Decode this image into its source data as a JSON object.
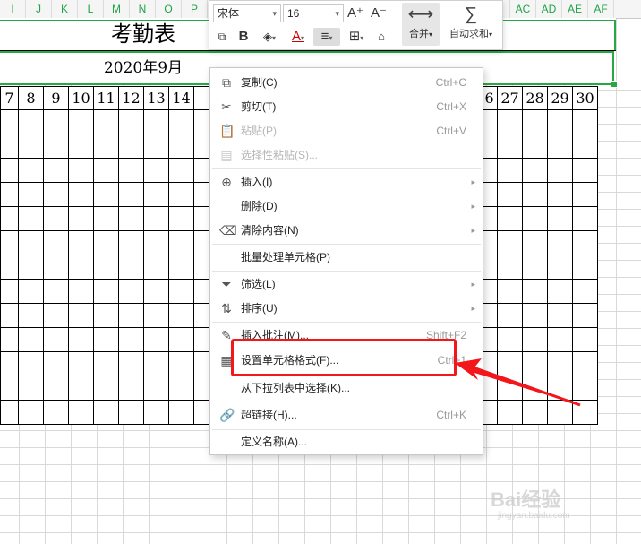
{
  "column_headers": [
    "I",
    "J",
    "K",
    "L",
    "M",
    "N",
    "O",
    "P",
    "",
    "",
    "",
    "",
    "",
    "",
    "",
    "",
    "",
    "",
    "",
    "",
    "",
    "",
    "",
    "AC",
    "AD",
    "AE",
    "AF"
  ],
  "sheet": {
    "title": "考勤表",
    "month": "2020年9月",
    "day_numbers": [
      "7",
      "8",
      "9",
      "10",
      "11",
      "12",
      "13",
      "14",
      "",
      "",
      "",
      "",
      "",
      "",
      "",
      "",
      "",
      "",
      "",
      "26",
      "27",
      "28",
      "29",
      "30"
    ]
  },
  "toolbar": {
    "font_name": "宋体",
    "font_size": "16",
    "grow_font_icon": "A⁺",
    "shrink_font_icon": "A⁻",
    "bold_label": "B",
    "font_color_label": "A",
    "merge_label": "合并",
    "autosum_label": "自动求和"
  },
  "context_menu": {
    "items": [
      {
        "icon": "copy-icon",
        "label": "复制(C)",
        "shortcut": "Ctrl+C",
        "disabled": false
      },
      {
        "icon": "cut-icon",
        "label": "剪切(T)",
        "shortcut": "Ctrl+X",
        "disabled": false
      },
      {
        "icon": "paste-icon",
        "label": "粘贴(P)",
        "shortcut": "Ctrl+V",
        "disabled": true
      },
      {
        "icon": "paste-special-icon",
        "label": "选择性粘贴(S)...",
        "shortcut": "",
        "disabled": true
      },
      {
        "icon": "insert-icon",
        "label": "插入(I)",
        "shortcut": "",
        "disabled": false,
        "submenu": true
      },
      {
        "icon": "",
        "label": "删除(D)",
        "shortcut": "",
        "disabled": false,
        "submenu": true
      },
      {
        "icon": "clear-icon",
        "label": "清除内容(N)",
        "shortcut": "",
        "disabled": false,
        "submenu": true
      },
      {
        "icon": "",
        "label": "批量处理单元格(P)",
        "shortcut": "",
        "disabled": false
      },
      {
        "icon": "filter-icon",
        "label": "筛选(L)",
        "shortcut": "",
        "disabled": false,
        "submenu": true
      },
      {
        "icon": "sort-icon",
        "label": "排序(U)",
        "shortcut": "",
        "disabled": false,
        "submenu": true
      },
      {
        "icon": "comment-icon",
        "label": "插入批注(M)...",
        "shortcut": "Shift+F2",
        "disabled": false
      },
      {
        "icon": "format-cells-icon",
        "label": "设置单元格格式(F)...",
        "shortcut": "Ctrl+1",
        "disabled": false
      },
      {
        "icon": "",
        "label": "从下拉列表中选择(K)...",
        "shortcut": "",
        "disabled": false
      },
      {
        "icon": "link-icon",
        "label": "超链接(H)...",
        "shortcut": "Ctrl+K",
        "disabled": false
      },
      {
        "icon": "",
        "label": "定义名称(A)...",
        "shortcut": "",
        "disabled": false
      }
    ]
  },
  "watermark": {
    "text": "Bai经验",
    "sub": "jingyan.baidu.com"
  },
  "colors": {
    "accent_green": "#27a845",
    "highlight_red": "#f2171b"
  }
}
